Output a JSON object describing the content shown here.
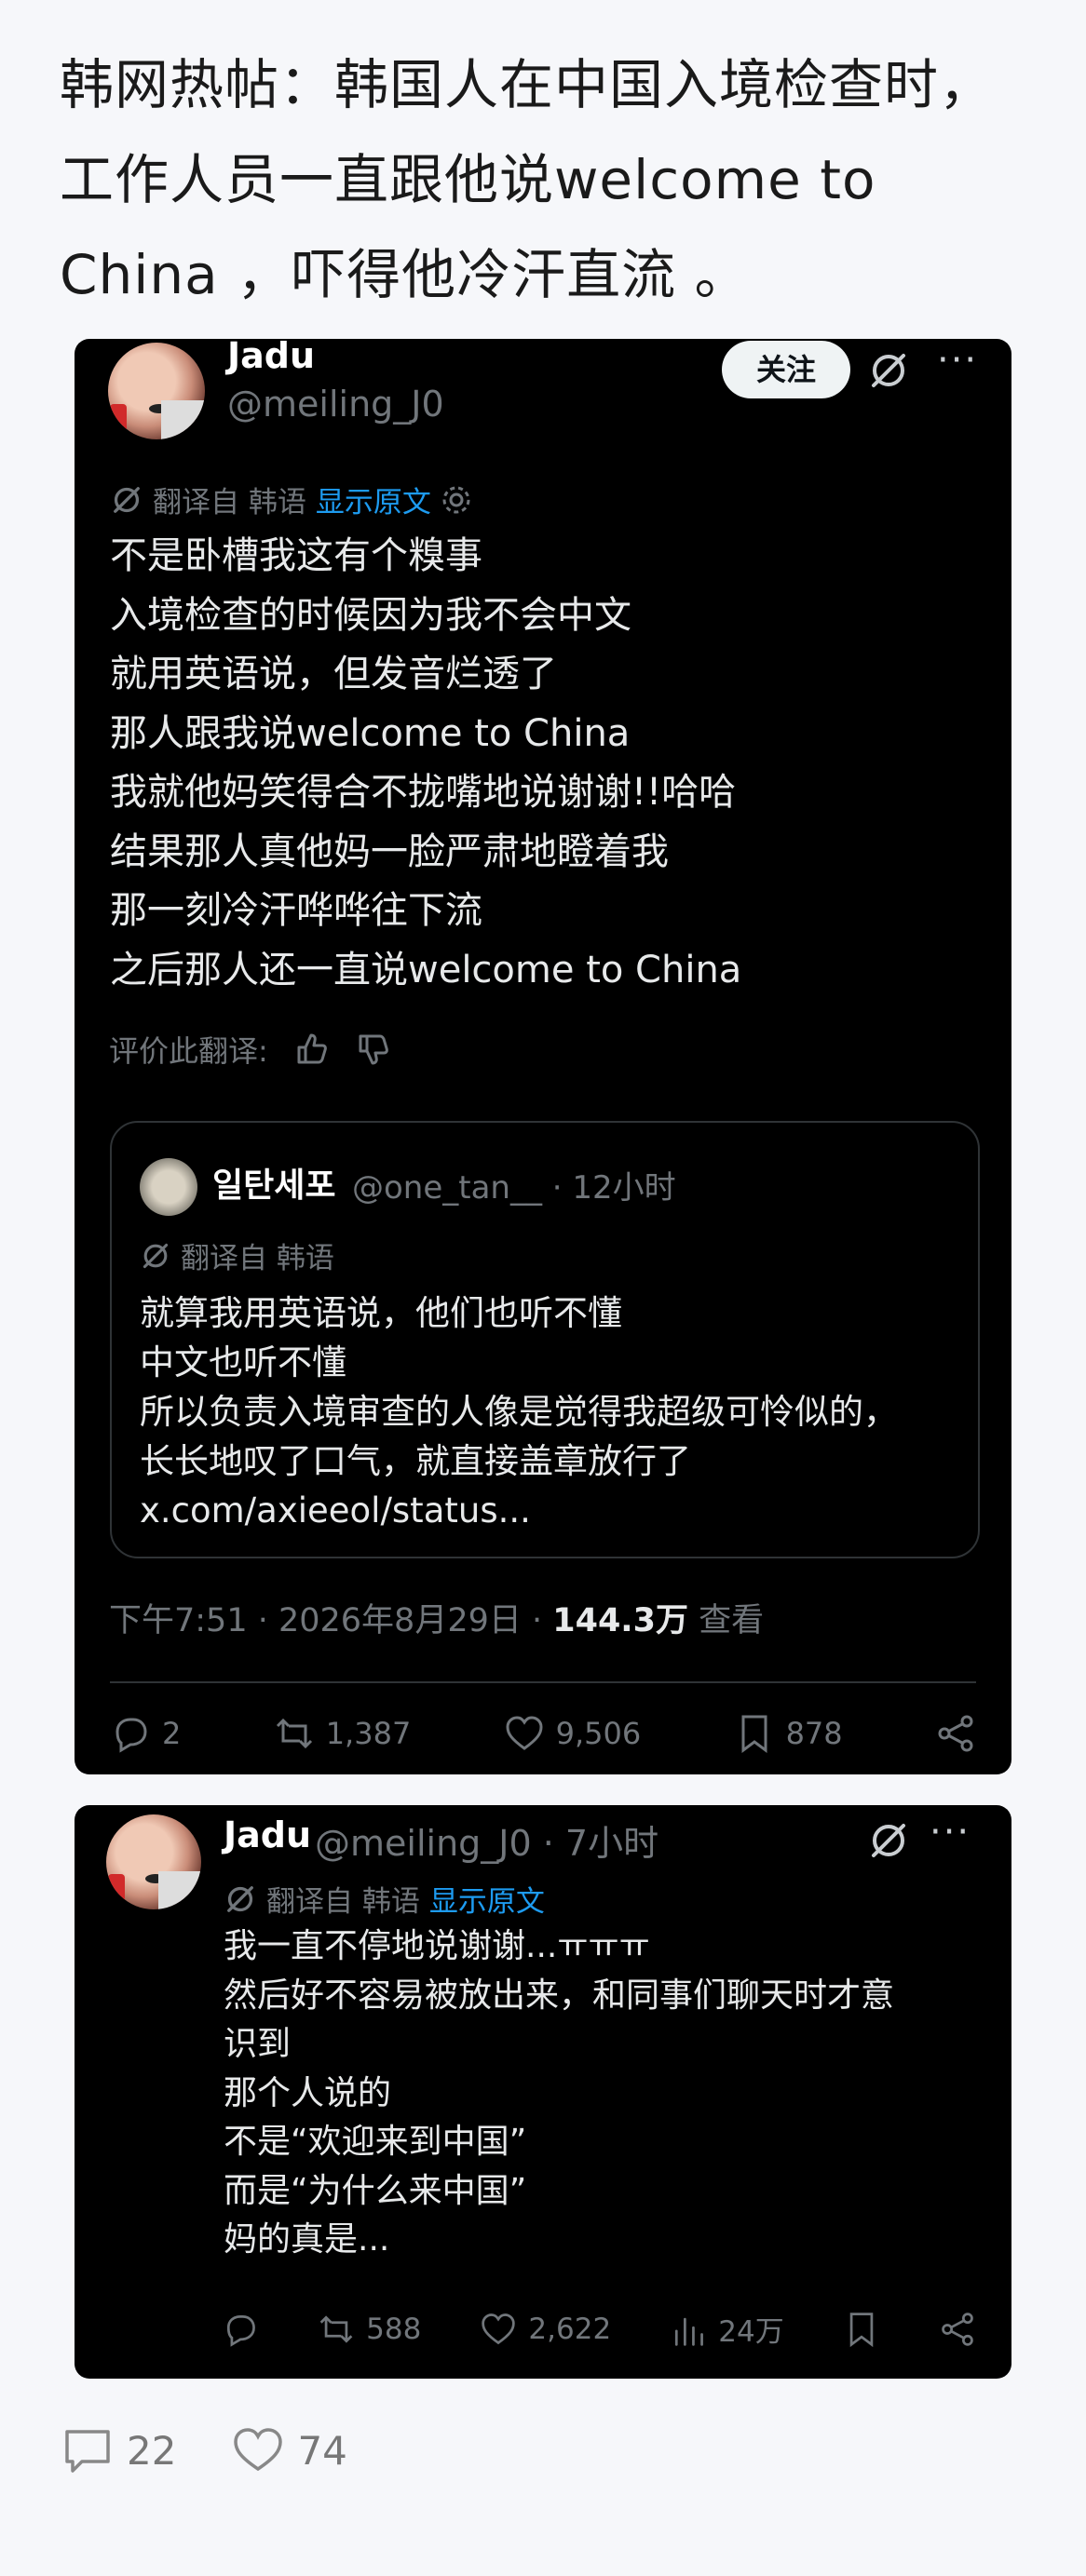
{
  "headline": "韩网热帖：韩国人在中国入境检查时，工作人员一直跟他说welcome to China ，吓得他冷汗直流 。",
  "post": {
    "name": "Jadu",
    "handle": "@meiling_J0",
    "follow_label": "关注",
    "translated_from": "翻译自 韩语",
    "show_original": "显示原文",
    "body": "不是卧槽我这有个糗事\n入境检查的时候因为我不会中文\n就用英语说，但发音烂透了\n那人跟我说welcome to China\n我就他妈笑得合不拢嘴地说谢谢!!哈哈\n结果那人真他妈一脸严肃地瞪着我\n那一刻冷汗哗哗往下流\n之后那人还一直说welcome to China",
    "rate_translation": "评价此翻译:",
    "quote": {
      "name": "일탄세포",
      "meta": "@one_tan__ · 12小时",
      "translated_from": "翻译自 韩语",
      "body": "就算我用英语说，他们也听不懂\n中文也听不懂\n所以负责入境审查的人像是觉得我超级可怜似的，\n长长地叹了口气，就直接盖章放行了\nx.com/axieeol/status..."
    },
    "timestamp": "下午7:51 · 2026年8月29日 · ",
    "views_count": "144.3万",
    "views_label": " 查看",
    "actions": {
      "replies": "2",
      "retweets": "1,387",
      "likes": "9,506",
      "bookmarks": "878"
    }
  },
  "reply": {
    "name": "Jadu",
    "meta": "@meiling_J0 · 7小时",
    "translated_from": "翻译自 韩语",
    "show_original": "显示原文",
    "body": "我一直不停地说谢谢...ㅠㅠㅠ\n然后好不容易被放出来，和同事们聊天时才意\n识到\n那个人说的\n不是“欢迎来到中国”\n而是“为什么来中国”\n妈的真是...",
    "actions": {
      "retweets": "588",
      "likes": "2,622",
      "views": "24万"
    }
  },
  "footer": {
    "comments": "22",
    "likes": "74"
  },
  "colors": {
    "card_bg": "#000000",
    "link": "#1d9bf0",
    "muted": "#71767b",
    "page_bg": "#f6f7fa"
  }
}
